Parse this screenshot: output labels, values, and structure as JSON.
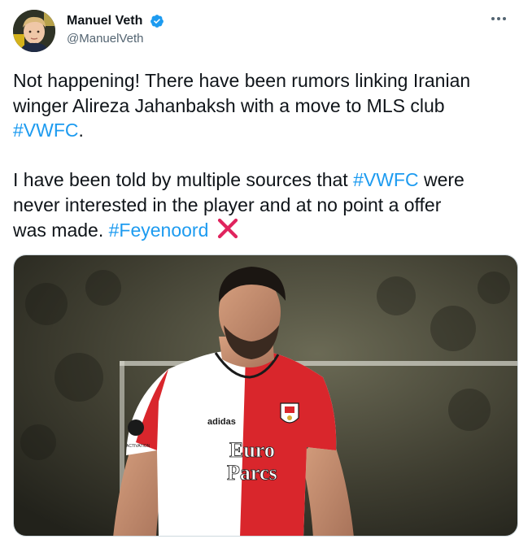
{
  "tweet": {
    "author": {
      "display_name": "Manuel Veth",
      "handle": "@ManuelVeth",
      "verified": true,
      "avatar_icon": "profile-photo"
    },
    "more_icon": "ellipsis-icon",
    "paragraphs": [
      [
        {
          "text": "Not happening! There have been rumors linking Iranian\nwinger Alireza Jahanbaksh with a move to MLS club\n",
          "type": "text"
        },
        {
          "text": "#VWFC",
          "type": "hashtag"
        },
        {
          "text": ".",
          "type": "text"
        }
      ],
      [
        {
          "text": "I have been told by multiple sources that ",
          "type": "text"
        },
        {
          "text": "#VWFC",
          "type": "hashtag"
        },
        {
          "text": " were\nnever interested in the player and at no point a offer\nwas made. ",
          "type": "text"
        },
        {
          "text": "#Feyenoord",
          "type": "hashtag"
        }
      ]
    ],
    "emoji": "cross-mark-icon",
    "media": {
      "jersey_sponsor_line1": "Euro",
      "jersey_sponsor_line2": "Parcs",
      "jersey_brand": "adidas",
      "badge": "feyenoord-crest",
      "sleeve_badge_text": "ACTIVATION"
    },
    "colors": {
      "hashtag": "#1d9bf0",
      "verified": "#1d9bf0",
      "cross": "#e0245e",
      "jersey_red": "#d9262c"
    }
  }
}
